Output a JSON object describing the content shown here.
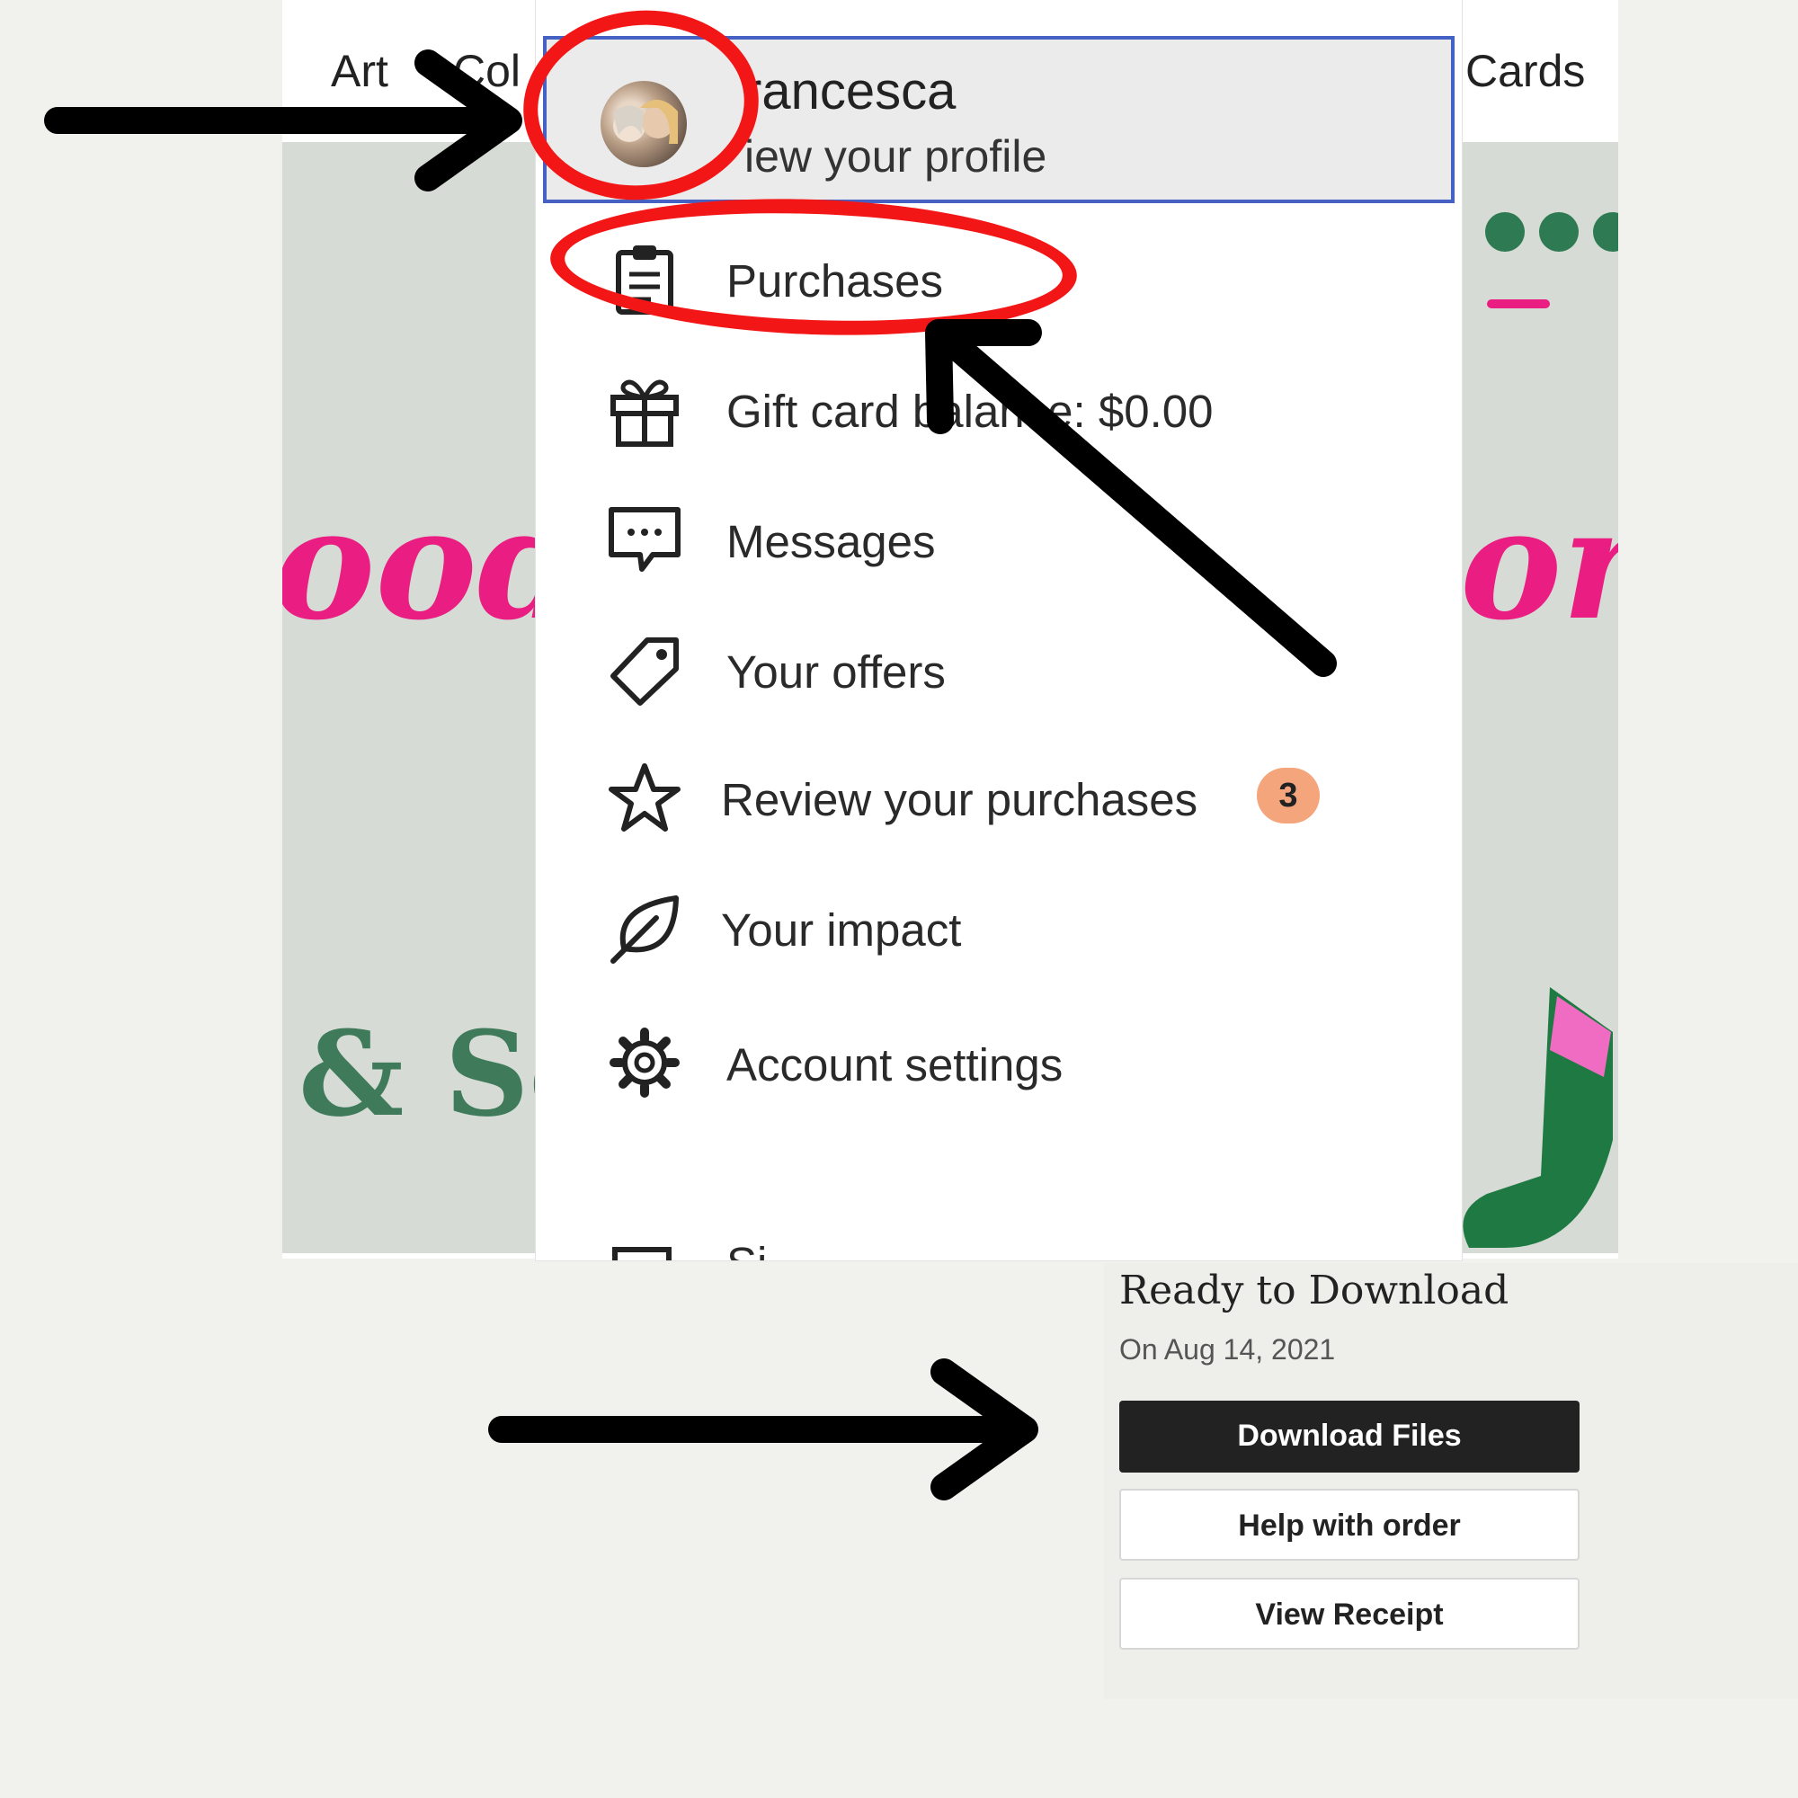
{
  "nav": {
    "left_word": "Art",
    "left_partial": "Col",
    "right_partial": "Cards"
  },
  "background": {
    "script_left": "ood",
    "script_right": "ore",
    "serif_left": "& Sc"
  },
  "profile": {
    "name": "rancesca",
    "subtitle": "iew your profile"
  },
  "menu": {
    "items": [
      {
        "label": "Purchases",
        "icon": "clipboard-icon"
      },
      {
        "label": "Gift card balance: $0.00",
        "icon": "gift-icon"
      },
      {
        "label": "Messages",
        "icon": "message-icon"
      },
      {
        "label": "Your offers",
        "icon": "tag-icon"
      },
      {
        "label": "Review your purchases",
        "icon": "star-icon",
        "badge": "3"
      },
      {
        "label": "Your impact",
        "icon": "leaf-icon"
      },
      {
        "label": "Account settings",
        "icon": "gear-icon"
      },
      {
        "label": "Si",
        "icon": "sign-out-icon"
      }
    ]
  },
  "download": {
    "title": "Ready to Download",
    "date": "On Aug 14, 2021",
    "download_label": "Download Files",
    "help_label": "Help with order",
    "receipt_label": "View Receipt"
  },
  "colors": {
    "annotation_red": "#f31616",
    "annotation_black": "#000000",
    "focus_blue": "#4461c3",
    "badge_orange": "#f4a57c",
    "brand_pink": "#ea1e82",
    "brand_green": "#3f7a5a"
  }
}
